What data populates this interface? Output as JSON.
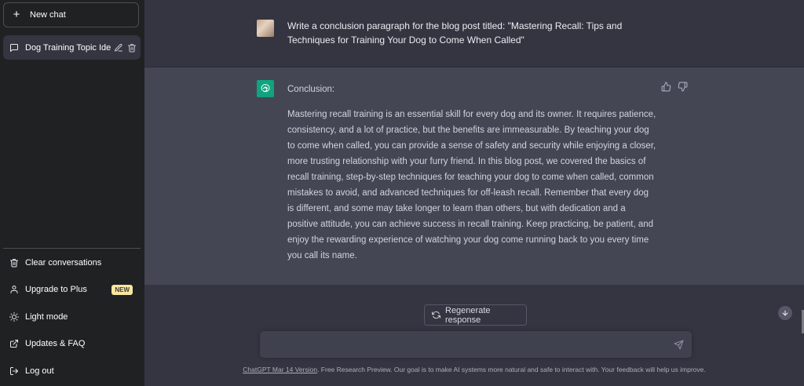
{
  "sidebar": {
    "new_chat": "New chat",
    "conversations": [
      {
        "title": "Dog Training Topic Ide",
        "icon": "message-icon"
      }
    ],
    "menu": [
      {
        "label": "Clear conversations",
        "icon": "trash-icon"
      },
      {
        "label": "Upgrade to Plus",
        "icon": "user-icon",
        "badge": "NEW"
      },
      {
        "label": "Light mode",
        "icon": "sun-icon"
      },
      {
        "label": "Updates & FAQ",
        "icon": "external-link-icon"
      },
      {
        "label": "Log out",
        "icon": "logout-icon"
      }
    ]
  },
  "thread": {
    "user_message": "Write a conclusion paragraph for the blog post titled: \"Mastering Recall: Tips and Techniques for Training Your Dog to Come When Called\"",
    "assistant_heading": "Conclusion:",
    "assistant_body": "Mastering recall training is an essential skill for every dog and its owner. It requires patience, consistency, and a lot of practice, but the benefits are immeasurable. By teaching your dog to come when called, you can provide a sense of safety and security while enjoying a closer, more trusting relationship with your furry friend. In this blog post, we covered the basics of recall training, step-by-step techniques for teaching your dog to come when called, common mistakes to avoid, and advanced techniques for off-leash recall. Remember that every dog is different, and some may take longer to learn than others, but with dedication and a positive attitude, you can achieve success in recall training. Keep practicing, be patient, and enjoy the rewarding experience of watching your dog come running back to you every time you call its name."
  },
  "composer": {
    "regenerate": "Regenerate response",
    "input_value": "",
    "input_placeholder": ""
  },
  "footer": {
    "version_link": "ChatGPT Mar 14 Version",
    "text": ". Free Research Preview. Our goal is to make AI systems more natural and safe to interact with. Your feedback will help us improve."
  },
  "colors": {
    "sidebar_bg": "#202123",
    "main_bg": "#343541",
    "assistant_bg": "#444654",
    "brand_green": "#10a37f",
    "badge_bg": "#fae69e"
  }
}
